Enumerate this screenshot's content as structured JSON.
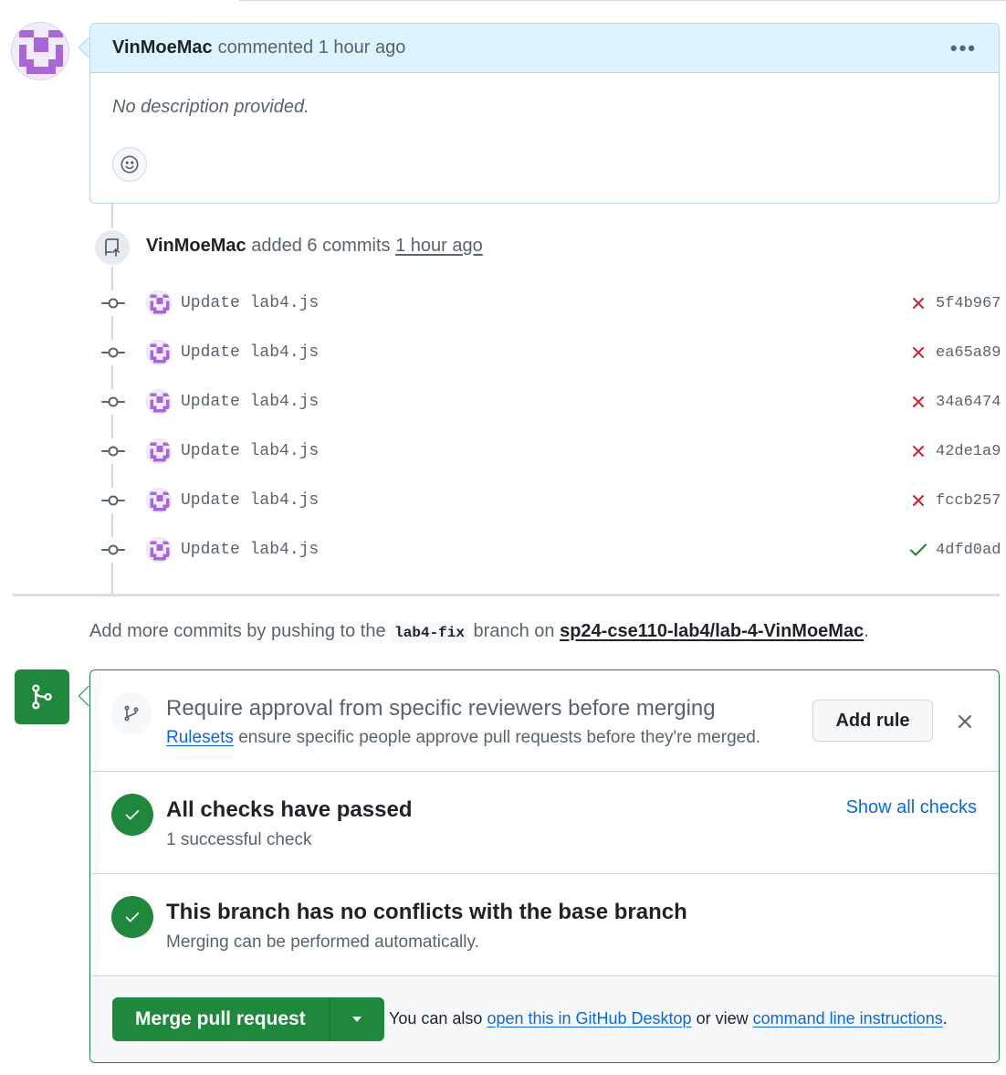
{
  "comment": {
    "author": "VinMoeMac",
    "meta": "commented 1 hour ago",
    "body": "No description provided."
  },
  "push_event": {
    "author": "VinMoeMac",
    "action": "added 6 commits",
    "time": "1 hour ago"
  },
  "commits": [
    {
      "message": "Update lab4.js",
      "sha": "5f4b967",
      "status": "fail"
    },
    {
      "message": "Update lab4.js",
      "sha": "ea65a89",
      "status": "fail"
    },
    {
      "message": "Update lab4.js",
      "sha": "34a6474",
      "status": "fail"
    },
    {
      "message": "Update lab4.js",
      "sha": "42de1a9",
      "status": "fail"
    },
    {
      "message": "Update lab4.js",
      "sha": "fccb257",
      "status": "fail"
    },
    {
      "message": "Update lab4.js",
      "sha": "4dfd0ad",
      "status": "success"
    }
  ],
  "push_hint": {
    "prefix": "Add more commits by pushing to the",
    "branch": "lab4-fix",
    "middle": "branch on",
    "repo": "sp24-cse110-lab4/lab-4-VinMoeMac",
    "suffix": "."
  },
  "merge_box": {
    "rule": {
      "title": "Require approval from specific reviewers before merging",
      "link": "Rulesets",
      "desc": "ensure specific people approve pull requests before they're merged.",
      "button": "Add rule"
    },
    "checks": {
      "title": "All checks have passed",
      "sub": "1 successful check",
      "link": "Show all checks"
    },
    "conflicts": {
      "title": "This branch has no conflicts with the base branch",
      "sub": "Merging can be performed automatically."
    },
    "merge": {
      "button": "Merge pull request",
      "alt_prefix": "You can also",
      "alt_link1": "open this in GitHub Desktop",
      "alt_middle": "or view",
      "alt_link2": "command line instructions",
      "alt_suffix": "."
    }
  },
  "colors": {
    "fail": "#cf222e",
    "success": "#1a7f37",
    "merge_green": "#1f883d",
    "link": "#0969da"
  }
}
